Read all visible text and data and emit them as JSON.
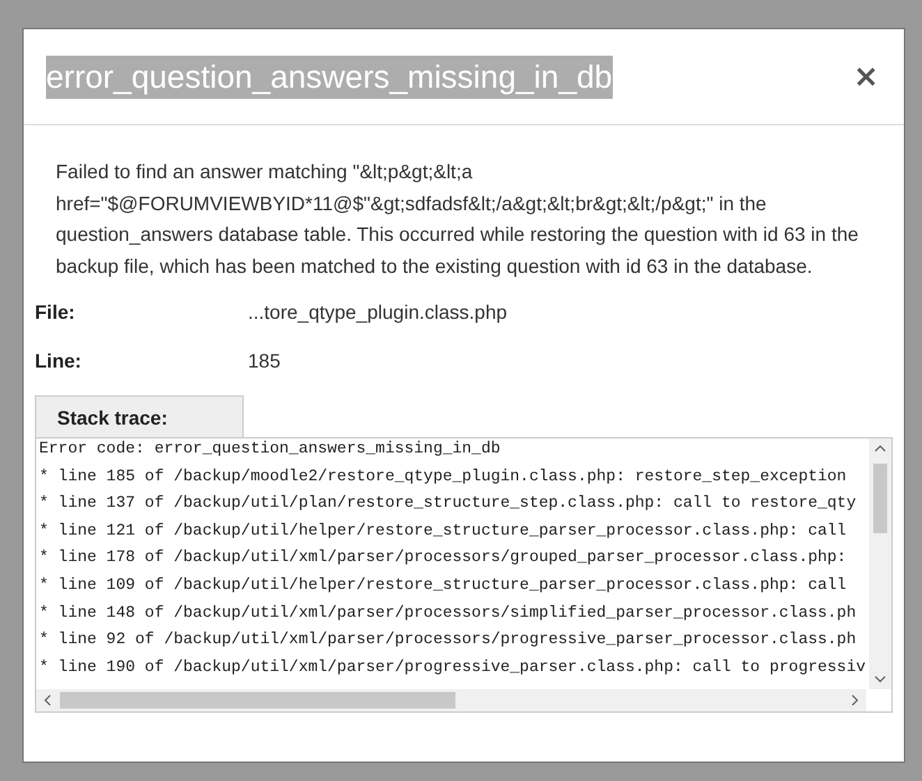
{
  "dialog": {
    "title": "error_question_answers_missing_in_db",
    "title_selected": true,
    "close": "×",
    "message": "Failed to find an answer matching \"&lt;p&gt;&lt;a href=\"$@FORUMVIEWBYID*11@$\"&gt;sdfadsf&lt;/a&gt;&lt;br&gt;&lt;/p&gt;\" in the question_answers database table. This occurred while restoring the question with id 63 in the backup file, which has been matched to the existing question with id 63 in the database.",
    "fields": [
      {
        "label": "File:",
        "value": "...tore_qtype_plugin.class.php"
      },
      {
        "label": "Line:",
        "value": "185"
      }
    ],
    "stack_trace": {
      "label": "Stack trace:",
      "lines": [
        "Error code: error_question_answers_missing_in_db",
        "* line 185 of /backup/moodle2/restore_qtype_plugin.class.php: restore_step_exception",
        "* line 137 of /backup/util/plan/restore_structure_step.class.php: call to restore_qty",
        "* line 121 of /backup/util/helper/restore_structure_parser_processor.class.php: call",
        "* line 178 of /backup/util/xml/parser/processors/grouped_parser_processor.class.php:",
        "* line 109 of /backup/util/helper/restore_structure_parser_processor.class.php: call",
        "* line 148 of /backup/util/xml/parser/processors/simplified_parser_processor.class.ph",
        "* line 92 of /backup/util/xml/parser/processors/progressive_parser_processor.class.ph",
        "* line 190 of /backup/util/xml/parser/progressive_parser.class.php: call to progressiv"
      ]
    }
  }
}
